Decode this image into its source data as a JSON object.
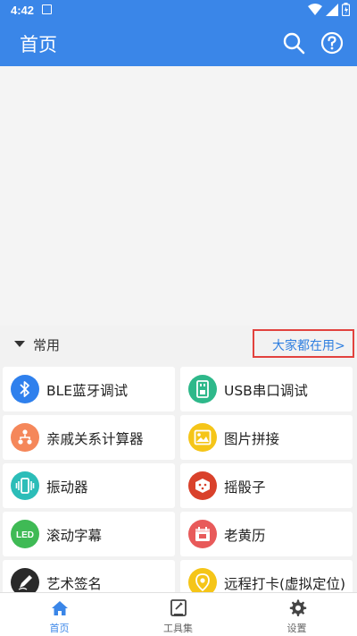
{
  "status_bar": {
    "time": "4:42"
  },
  "app_bar": {
    "title": "首页"
  },
  "section": {
    "label": "常用",
    "more_link": "大家都在用>"
  },
  "tools": [
    {
      "label": "BLE蓝牙调试",
      "icon": "bluetooth-icon",
      "color": "#2f80ed"
    },
    {
      "label": "USB串口调试",
      "icon": "usb-serial-icon",
      "color": "#2eb88a"
    },
    {
      "label": "亲戚关系计算器",
      "icon": "family-tree-icon",
      "color": "#f5875a"
    },
    {
      "label": "图片拼接",
      "icon": "image-stitch-icon",
      "color": "#f5c518"
    },
    {
      "label": "振动器",
      "icon": "vibrate-icon",
      "color": "#2cbdb8"
    },
    {
      "label": "摇骰子",
      "icon": "dice-icon",
      "color": "#d9412b"
    },
    {
      "label": "滚动字幕",
      "icon": "led-icon",
      "color": "#3fba55"
    },
    {
      "label": "老黄历",
      "icon": "calendar-icon",
      "color": "#e85a5a"
    },
    {
      "label": "艺术签名",
      "icon": "pen-icon",
      "color": "#2a2a2a"
    },
    {
      "label": "远程打卡(虚拟定位)",
      "icon": "location-icon",
      "color": "#f5c518"
    }
  ],
  "bottom_nav": [
    {
      "label": "首页",
      "icon": "home-icon",
      "active": true
    },
    {
      "label": "工具集",
      "icon": "toolbox-icon",
      "active": false
    },
    {
      "label": "设置",
      "icon": "settings-gear-icon",
      "active": false
    }
  ],
  "colors": {
    "primary": "#3a86e8",
    "highlight_border": "#e2423e",
    "link": "#2f7fe0"
  }
}
